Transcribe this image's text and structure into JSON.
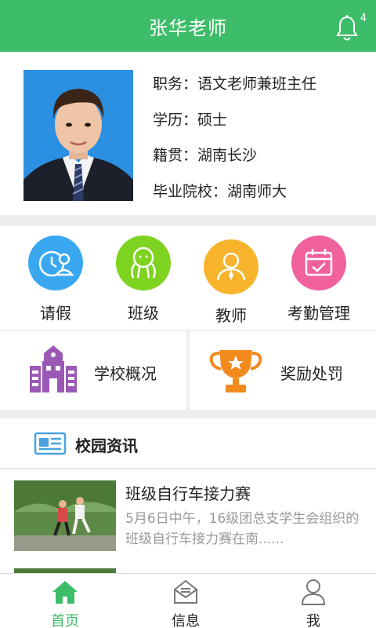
{
  "header": {
    "title": "张华老师",
    "notification_count": "4"
  },
  "profile": {
    "position": "职务：语文老师兼班主任",
    "education": "学历：硕士",
    "hometown": "籍贯：湖南长沙",
    "school": "毕业院校：湖南师大"
  },
  "grid": [
    {
      "label": "请假",
      "icon": "leave-icon",
      "color": "#3aa8f0"
    },
    {
      "label": "班级",
      "icon": "class-icon",
      "color": "#7ed321"
    },
    {
      "label": "教师",
      "icon": "teacher-icon",
      "color": "#f7b42c"
    },
    {
      "label": "考勤管理",
      "icon": "calendar-check-icon",
      "color": "#f0619e"
    }
  ],
  "tiles": [
    {
      "label": "学校概况",
      "icon": "school-building-icon",
      "color": "#9b59b6"
    },
    {
      "label": "奖励处罚",
      "icon": "trophy-icon",
      "color": "#f28a1e"
    }
  ],
  "news": {
    "section_title": "校园资讯",
    "items": [
      {
        "title": "班级自行车接力赛",
        "desc": "5月6日中午，16级团总支学生会组织的班级自行车接力赛在南......"
      }
    ]
  },
  "tabbar": [
    {
      "label": "首页",
      "icon": "home-icon",
      "active": true
    },
    {
      "label": "信息",
      "icon": "message-icon",
      "active": false
    },
    {
      "label": "我",
      "icon": "user-icon",
      "active": false
    }
  ],
  "colors": {
    "accent": "#3dbd6a",
    "background": "#eeeeee",
    "muted_text": "#999999"
  }
}
